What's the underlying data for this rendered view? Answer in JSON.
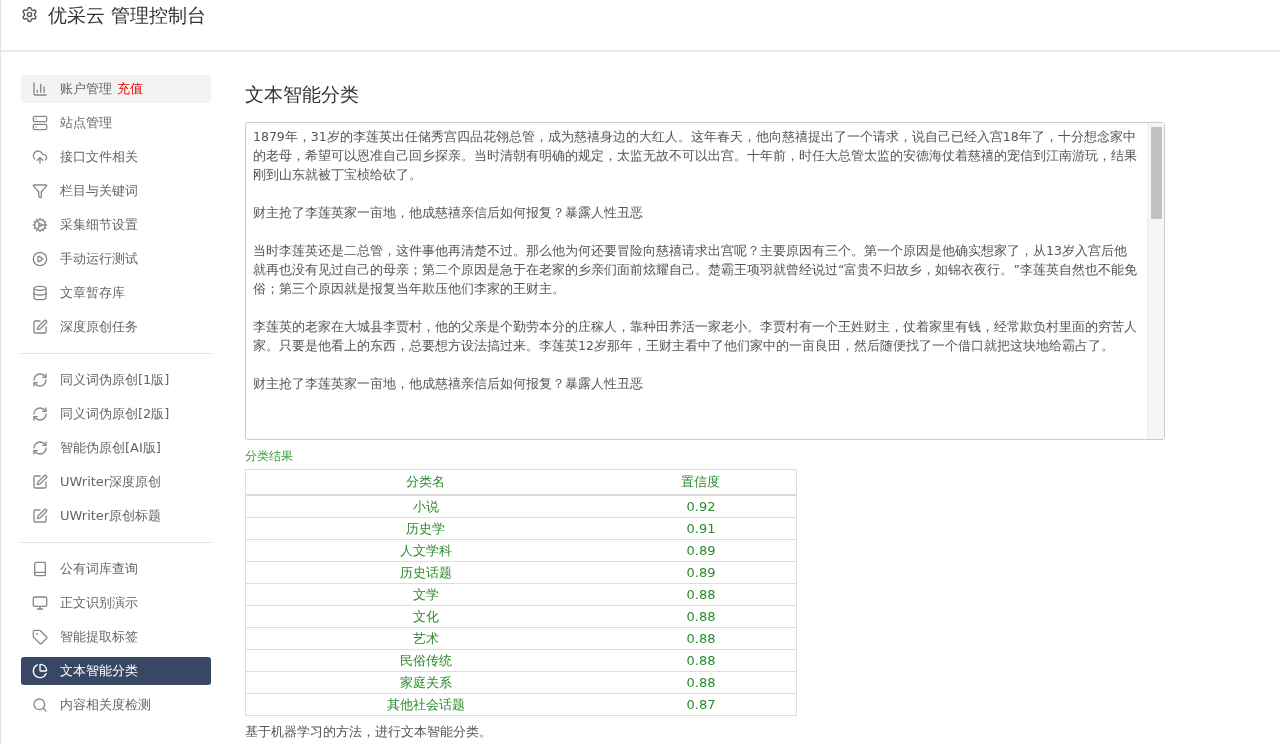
{
  "header": {
    "title": "优采云 管理控制台"
  },
  "sidebar": {
    "groups": [
      {
        "items": [
          {
            "label": "账户管理",
            "badge": "充值",
            "selected": false,
            "highlighted": true
          },
          {
            "label": "站点管理",
            "selected": false,
            "highlighted": false
          },
          {
            "label": "接口文件相关",
            "selected": false,
            "highlighted": false
          },
          {
            "label": "栏目与关键词",
            "selected": false,
            "highlighted": false
          },
          {
            "label": "采集细节设置",
            "selected": false,
            "highlighted": false
          },
          {
            "label": "手动运行测试",
            "selected": false,
            "highlighted": false
          },
          {
            "label": "文章暂存库",
            "selected": false,
            "highlighted": false
          },
          {
            "label": "深度原创任务",
            "selected": false,
            "highlighted": false
          }
        ]
      },
      {
        "items": [
          {
            "label": "同义词伪原创[1版]",
            "selected": false,
            "highlighted": false
          },
          {
            "label": "同义词伪原创[2版]",
            "selected": false,
            "highlighted": false
          },
          {
            "label": "智能伪原创[AI版]",
            "selected": false,
            "highlighted": false
          },
          {
            "label": "UWriter深度原创",
            "selected": false,
            "highlighted": false
          },
          {
            "label": "UWriter原创标题",
            "selected": false,
            "highlighted": false
          }
        ]
      },
      {
        "items": [
          {
            "label": "公有词库查询",
            "selected": false,
            "highlighted": false
          },
          {
            "label": "正文识别演示",
            "selected": false,
            "highlighted": false
          },
          {
            "label": "智能提取标签",
            "selected": false,
            "highlighted": false
          },
          {
            "label": "文本智能分类",
            "selected": true,
            "highlighted": false
          },
          {
            "label": "内容相关度检测",
            "selected": false,
            "highlighted": false
          }
        ]
      }
    ]
  },
  "main": {
    "title": "文本智能分类",
    "text_input": {
      "paragraphs": [
        "1879年，31岁的李莲英出任储秀宫四品花翎总管，成为慈禧身边的大红人。这年春天，他向慈禧提出了一个请求，说自己已经入宫18年了，十分想念家中的老母，希望可以恩准自己回乡探亲。当时清朝有明确的规定，太监无故不可以出宫。十年前，时任大总管太监的安德海仗着慈禧的宠信到江南游玩，结果刚到山东就被丁宝桢给砍了。",
        "财主抢了李莲英家一亩地，他成慈禧亲信后如何报复？暴露人性丑恶",
        "当时李莲英还是二总管，这件事他再清楚不过。那么他为何还要冒险向慈禧请求出宫呢？主要原因有三个。第一个原因是他确实想家了，从13岁入宫后他就再也没有见过自己的母亲；第二个原因是急于在老家的乡亲们面前炫耀自己。楚霸王项羽就曾经说过“富贵不归故乡，如锦衣夜行。”李莲英自然也不能免俗；第三个原因就是报复当年欺压他们李家的王财主。",
        "李莲英的老家在大城县李贾村，他的父亲是个勤劳本分的庄稼人，靠种田养活一家老小。李贾村有一个王姓财主，仗着家里有钱，经常欺负村里面的穷苦人家。只要是他看上的东西，总要想方设法搞过来。李莲英12岁那年，王财主看中了他们家中的一亩良田，然后随便找了一个借口就把这块地给霸占了。",
        "财主抢了李莲英家一亩地，他成慈禧亲信后如何报复？暴露人性丑恶"
      ]
    },
    "results": {
      "label": "分类结果",
      "columns": [
        "分类名",
        "置信度"
      ],
      "rows": [
        [
          "小说",
          "0.92"
        ],
        [
          "历史学",
          "0.91"
        ],
        [
          "人文学科",
          "0.89"
        ],
        [
          "历史话题",
          "0.89"
        ],
        [
          "文学",
          "0.88"
        ],
        [
          "文化",
          "0.88"
        ],
        [
          "艺术",
          "0.88"
        ],
        [
          "民俗传统",
          "0.88"
        ],
        [
          "家庭关系",
          "0.88"
        ],
        [
          "其他社会话题",
          "0.87"
        ]
      ]
    },
    "note": "基于机器学习的方法，进行文本智能分类。"
  }
}
